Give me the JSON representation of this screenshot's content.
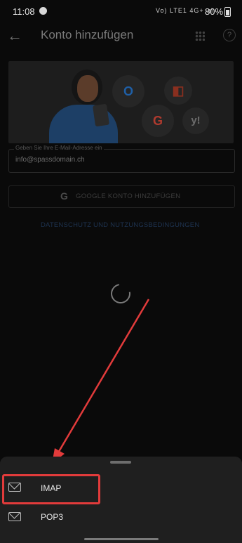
{
  "status_bar": {
    "time": "11:08",
    "indicators": "Vo) LTE1 4G+ .ıl",
    "battery": "80%"
  },
  "app_bar": {
    "title": "Konto hinzufügen"
  },
  "hero": {
    "apps": [
      "outlook-logo",
      "office-logo",
      "google-logo",
      "yahoo-logo"
    ]
  },
  "email_field": {
    "label": "Geben Sie Ihre E-Mail-Adresse ein",
    "value": "info@spassdomain.ch"
  },
  "google_button": {
    "label": "GOOGLE KONTO HINZUFÜGEN"
  },
  "privacy_link": "DATENSCHUTZ UND NUTZUNGSBEDINGUNGEN",
  "sheet": {
    "options": [
      {
        "label": "IMAP"
      },
      {
        "label": "POP3"
      }
    ]
  },
  "colors": {
    "background": "#0a0a0a",
    "sheet": "#1f1f1f",
    "annotation": "#e23b3b"
  }
}
